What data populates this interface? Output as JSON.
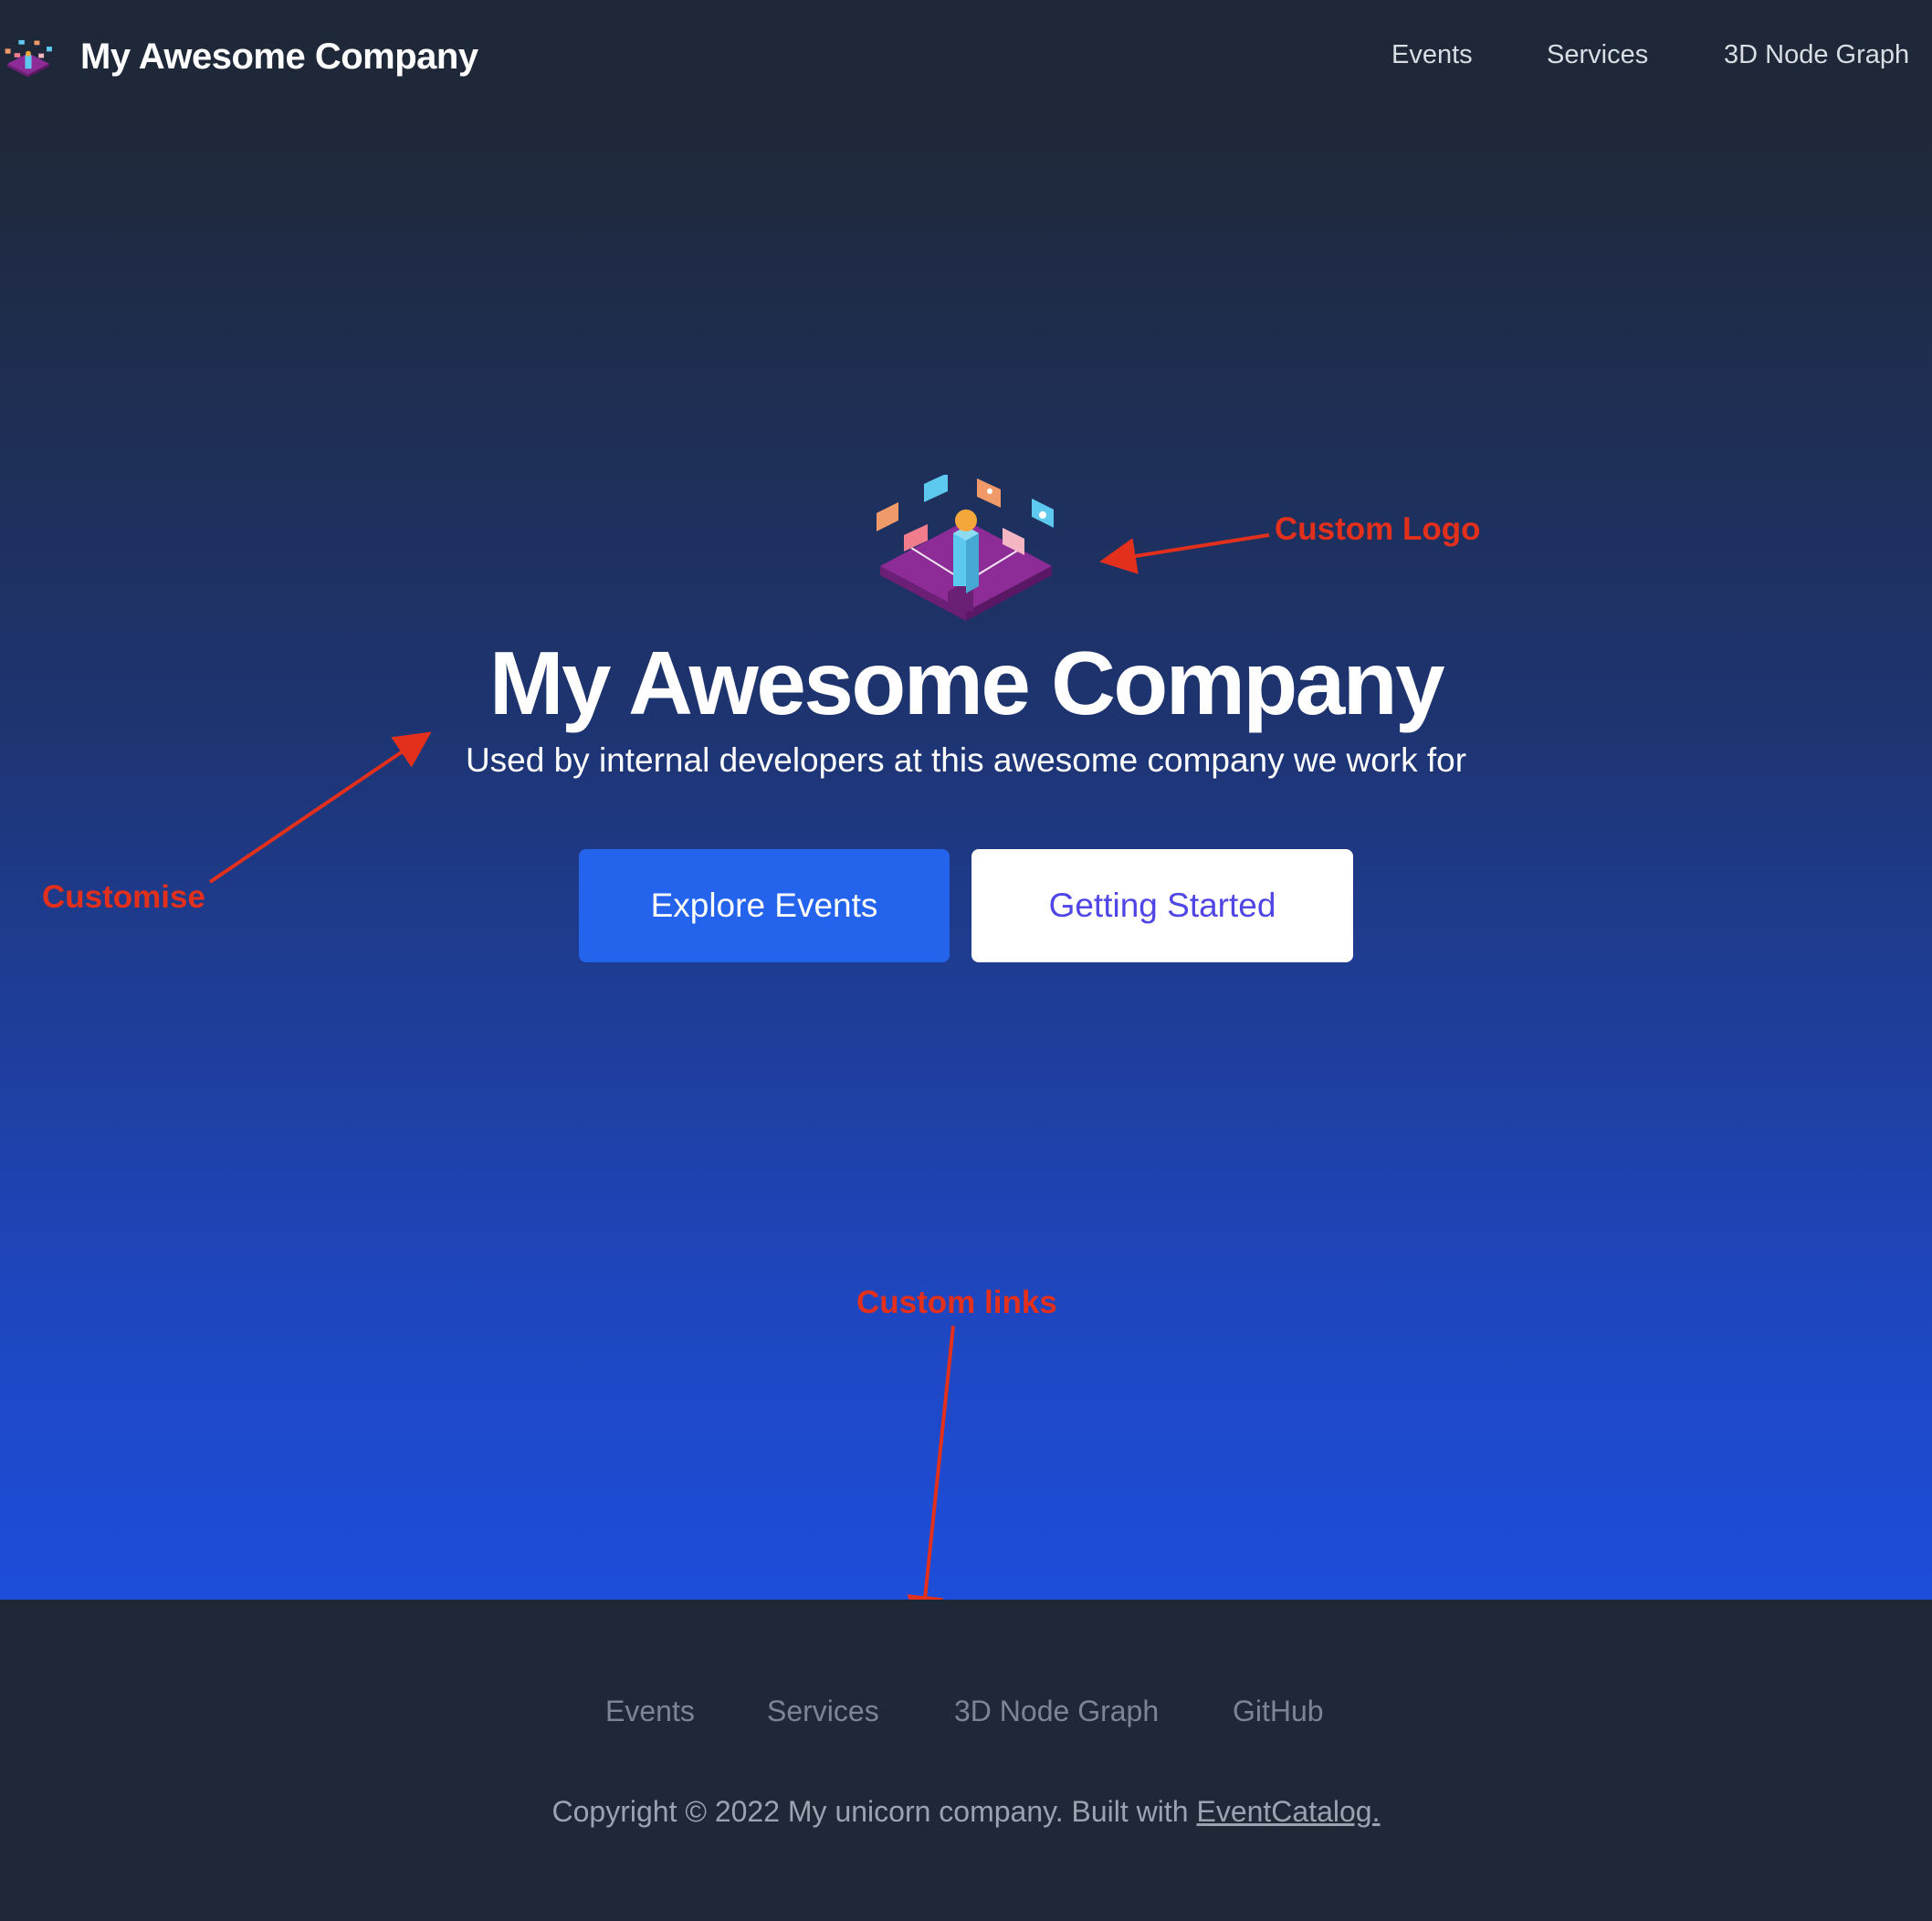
{
  "navbar": {
    "brand_title": "My Awesome Company",
    "links": [
      "Events",
      "Services",
      "3D Node Graph"
    ]
  },
  "hero": {
    "title": "My Awesome Company",
    "subtitle": "Used by internal developers at this awesome company we work for",
    "primary_button": "Explore Events",
    "secondary_button": "Getting Started"
  },
  "annotations": {
    "logo": "Custom Logo",
    "customise": "Customise",
    "links": "Custom links"
  },
  "footer": {
    "links": [
      "Events",
      "Services",
      "3D Node Graph",
      "GitHub"
    ],
    "copyright_prefix": "Copyright © 2022 My unicorn company. Built with ",
    "copyright_link": "EventCatalog."
  },
  "colors": {
    "background_dark": "#1f2837",
    "primary_button": "#2463eb",
    "secondary_button_text": "#4f46e5",
    "annotation": "#e3301c"
  },
  "icons": [
    "company-logo-icon",
    "arrow-icon"
  ]
}
